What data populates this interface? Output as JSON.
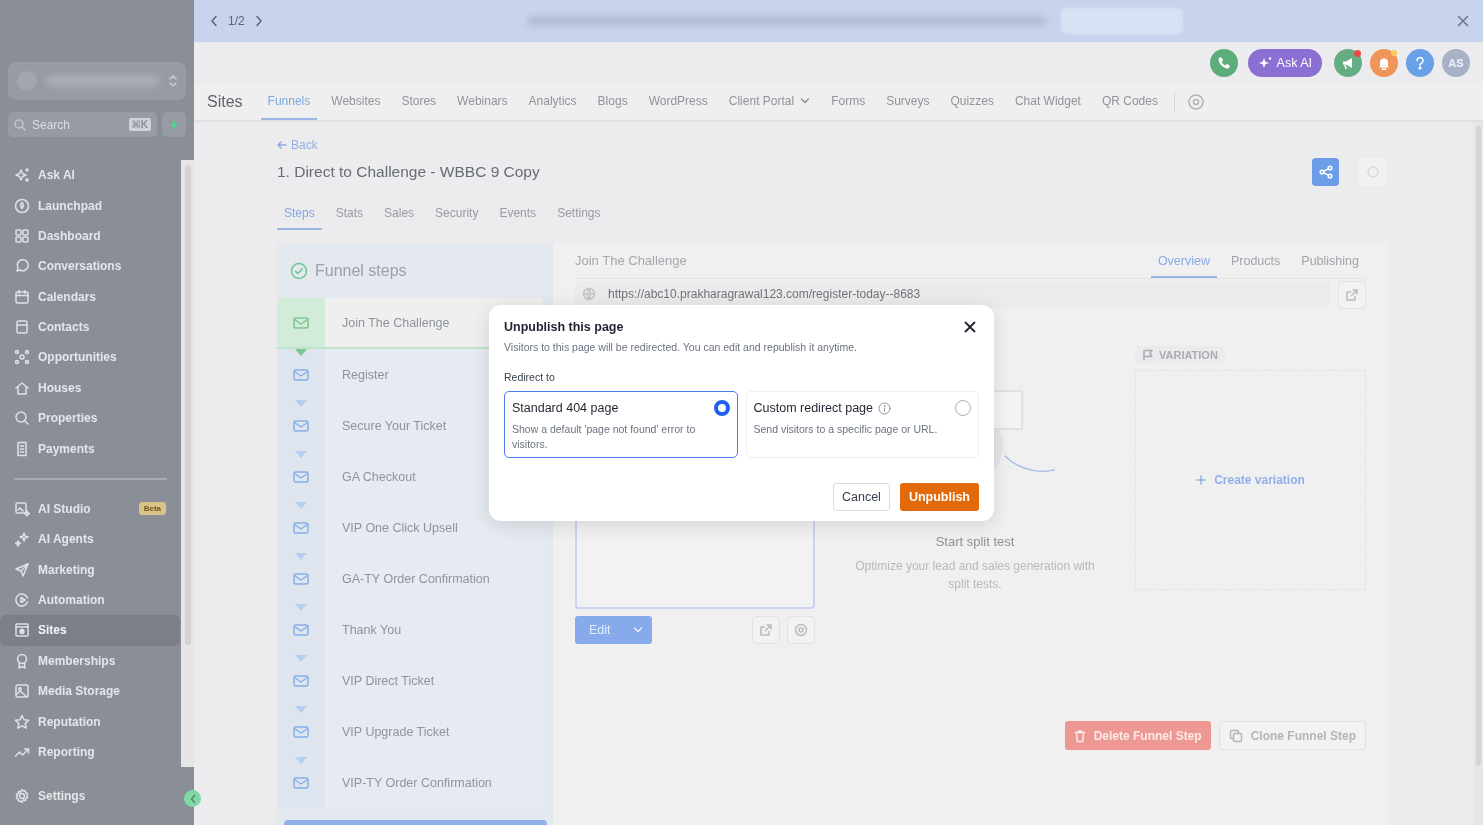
{
  "banner": {
    "pager": "1/2"
  },
  "sidebar": {
    "search": {
      "placeholder": "Search",
      "shortcut": "⌘K"
    },
    "groups": [
      [
        {
          "label": "Ask AI",
          "selected": false
        },
        {
          "label": "Launchpad",
          "selected": false
        },
        {
          "label": "Dashboard",
          "selected": false
        },
        {
          "label": "Conversations",
          "selected": false
        },
        {
          "label": "Calendars",
          "selected": false
        },
        {
          "label": "Contacts",
          "selected": false
        },
        {
          "label": "Opportunities",
          "selected": false
        },
        {
          "label": "Houses",
          "selected": false
        },
        {
          "label": "Properties",
          "selected": false
        },
        {
          "label": "Payments",
          "selected": false
        }
      ],
      [
        {
          "label": "AI Studio",
          "selected": false,
          "badge": "Beta"
        },
        {
          "label": "AI Agents",
          "selected": false
        },
        {
          "label": "Marketing",
          "selected": false
        },
        {
          "label": "Automation",
          "selected": false
        },
        {
          "label": "Sites",
          "selected": true
        },
        {
          "label": "Memberships",
          "selected": false
        },
        {
          "label": "Media Storage",
          "selected": false
        },
        {
          "label": "Reputation",
          "selected": false
        },
        {
          "label": "Reporting",
          "selected": false
        }
      ]
    ],
    "settings": "Settings"
  },
  "header_actions": {
    "ask_ai": "Ask AI",
    "avatar": "AS"
  },
  "app_nav": {
    "title": "Sites",
    "tabs": [
      {
        "label": "Funnels",
        "selected": true
      },
      {
        "label": "Websites",
        "selected": false
      },
      {
        "label": "Stores",
        "selected": false
      },
      {
        "label": "Webinars",
        "selected": false
      },
      {
        "label": "Analytics",
        "selected": false
      },
      {
        "label": "Blogs",
        "selected": false
      },
      {
        "label": "WordPress",
        "selected": false
      },
      {
        "label": "Client Portal",
        "selected": false,
        "dropdown": true
      },
      {
        "label": "Forms",
        "selected": false
      },
      {
        "label": "Surveys",
        "selected": false
      },
      {
        "label": "Quizzes",
        "selected": false
      },
      {
        "label": "Chat Widget",
        "selected": false
      },
      {
        "label": "QR Codes",
        "selected": false
      }
    ]
  },
  "funnel": {
    "back": "Back",
    "title": "1. Direct to Challenge - WBBC 9 Copy",
    "tabs": [
      {
        "label": "Steps",
        "selected": true
      },
      {
        "label": "Stats",
        "selected": false
      },
      {
        "label": "Sales",
        "selected": false
      },
      {
        "label": "Security",
        "selected": false
      },
      {
        "label": "Events",
        "selected": false
      },
      {
        "label": "Settings",
        "selected": false
      }
    ]
  },
  "steps": {
    "title": "Funnel steps",
    "items": [
      {
        "label": "Join The Challenge",
        "selected": true
      },
      {
        "label": "Register",
        "selected": false
      },
      {
        "label": "Secure Your Ticket",
        "selected": false
      },
      {
        "label": "GA Checkout",
        "selected": false
      },
      {
        "label": "VIP One Click Upsell",
        "selected": false
      },
      {
        "label": "GA-TY Order Confirmation",
        "selected": false
      },
      {
        "label": "Thank You",
        "selected": false
      },
      {
        "label": "VIP Direct Ticket",
        "selected": false
      },
      {
        "label": "VIP Upgrade Ticket",
        "selected": false
      },
      {
        "label": "VIP-TY Order Confirmation",
        "selected": false
      }
    ]
  },
  "step_detail": {
    "title": "Join The Challenge",
    "tabs": [
      {
        "label": "Overview",
        "selected": true
      },
      {
        "label": "Products",
        "selected": false
      },
      {
        "label": "Publishing",
        "selected": false
      }
    ],
    "url": "https://abc10.prakharagrawal123.com/register-today--8683",
    "edit": "Edit",
    "split_test": {
      "title": "Start split test",
      "description": "Optimize your lead and sales generation with split tests."
    },
    "variation": {
      "label": "VARIATION",
      "create": "Create variation"
    },
    "delete": "Delete Funnel Step",
    "clone": "Clone Funnel Step"
  },
  "dialog": {
    "title": "Unpublish this page",
    "description": "Visitors to this page will be redirected. You can edit and republish it anytime.",
    "redirect_label": "Redirect to",
    "options": [
      {
        "title": "Standard 404 page",
        "description": "Show a default 'page not found' error to visitors.",
        "selected": true,
        "info": false
      },
      {
        "title": "Custom redirect page",
        "description": "Send visitors to a specific page or URL.",
        "selected": false,
        "info": true
      }
    ],
    "cancel": "Cancel",
    "confirm": "Unpublish"
  }
}
